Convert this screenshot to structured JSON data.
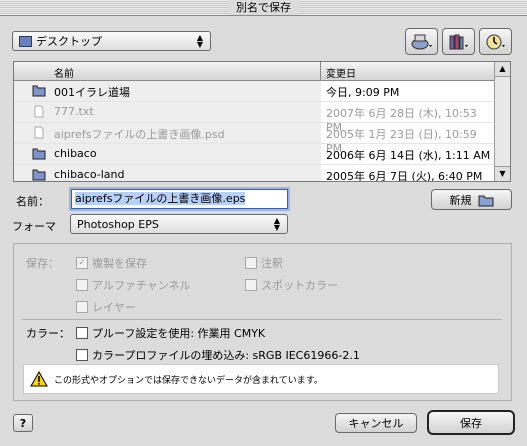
{
  "window": {
    "title": "別名で保存"
  },
  "location": {
    "selected": "デスクトップ"
  },
  "files": {
    "col_name": "名前",
    "col_date": "変更日",
    "rows": [
      {
        "name": "001イラレ道場",
        "date": "今日, 9:09 PM",
        "type": "folder",
        "dim": false
      },
      {
        "name": "777.txt",
        "date": "2007年 6月 28日 (木), 10:53 PM",
        "type": "document",
        "dim": true
      },
      {
        "name": "aiprefsファイルの上書き画像.psd",
        "date": "2005年 1月 23日 (日), 10:59 PM",
        "type": "document",
        "dim": true
      },
      {
        "name": "chibaco",
        "date": "2006年 6月 14日 (水), 1:11 AM",
        "type": "folder",
        "dim": false
      },
      {
        "name": "chibaco-land",
        "date": "2005年 6月 7日 (火), 6:40 PM",
        "type": "folder",
        "dim": false
      }
    ]
  },
  "name_field": {
    "label": "名前：",
    "value": "aiprefsファイルの上書き画像.eps"
  },
  "new_folder_button": "新規",
  "format": {
    "label": "フォーマット：",
    "label_shown": "フォーマ",
    "value": "Photoshop EPS"
  },
  "save_options": {
    "label": "保存：",
    "options": [
      {
        "label": "複製を保存",
        "checked": true,
        "enabled": false
      },
      {
        "label": "注釈",
        "checked": false,
        "enabled": false
      },
      {
        "label": "アルファチャンネル",
        "checked": false,
        "enabled": false
      },
      {
        "label": "スポットカラー",
        "checked": false,
        "enabled": false
      },
      {
        "label": "レイヤー",
        "checked": false,
        "enabled": false
      }
    ]
  },
  "color": {
    "label": "カラー：",
    "proof": "プルーフ設定を使用: 作業用 CMYK",
    "embed": "カラープロファイルの埋め込み: sRGB IEC61966-2.1"
  },
  "warning": "この形式やオプションでは保存できないデータが含まれています。",
  "buttons": {
    "cancel": "キャンセル",
    "save": "保存",
    "help": "?"
  }
}
